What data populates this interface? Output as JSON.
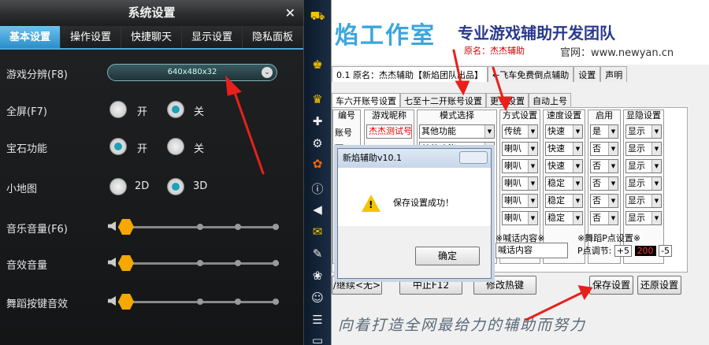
{
  "game_settings": {
    "title": "系统设置",
    "close": "✕",
    "tabs": [
      "基本设置",
      "操作设置",
      "快捷聊天",
      "显示设置",
      "隐私面板"
    ],
    "resolution": {
      "label": "游戏分辨(F8)",
      "value": "640x480x32"
    },
    "fullscreen": {
      "label": "全屏(F7)",
      "opt_on": "开",
      "opt_off": "关"
    },
    "gem": {
      "label": "宝石功能",
      "opt_on": "开",
      "opt_off": "关"
    },
    "minimap": {
      "label": "小地图",
      "opt_2d": "2D",
      "opt_3d": "3D"
    },
    "music_volume": {
      "label": "音乐音量(F6)",
      "level": 0
    },
    "sfx_volume": {
      "label": "音效音量",
      "level": 0
    },
    "dance_key_sound": {
      "label": "舞蹈按键音效",
      "level": 0
    }
  },
  "helper_app": {
    "banner_title": "焰工作室",
    "banner_sub": "专业游戏辅助开发团队",
    "banner_small": "原名：杰杰辅助",
    "banner_site": "官网：www.newyan.cn",
    "top_tabs": [
      "0.1 原名：杰杰辅助【新焰团队出品】",
      "←飞车免费倒点辅助",
      "设置",
      "声明"
    ],
    "account_tabs": [
      "车六开账号设置",
      "七至十二开账号设置",
      "更多设置",
      "自动上号"
    ],
    "columns": {
      "id": {
        "header": "编号",
        "cells": [
          "账号一",
          "",
          "",
          "",
          "",
          ""
        ]
      },
      "nickname": {
        "header": "游戏昵称",
        "cells": [
          "杰杰测试号码丶"
        ]
      },
      "mode": {
        "header": "模式选择",
        "cells": [
          "其他功能",
          "其他功能"
        ]
      },
      "method": {
        "header": "方式设置",
        "cells": [
          "传统",
          "喇叭",
          "喇叭",
          "喇叭",
          "喇叭",
          "喇叭"
        ]
      },
      "speed": {
        "header": "速度设置",
        "cells": [
          "快速",
          "快速",
          "快速",
          "稳定",
          "稳定",
          "稳定"
        ]
      },
      "enable": {
        "header": "启用",
        "cells": [
          "是",
          "否",
          "否",
          "否",
          "否",
          "否"
        ]
      },
      "visibility": {
        "header": "显隐设置",
        "cells": [
          "显示",
          "显示",
          "显示",
          "显示",
          "显示",
          "显示"
        ]
      }
    },
    "shout": {
      "title": "※喊话内容※",
      "value": "喊话内容"
    },
    "p_point": {
      "title": "※舞蹈P点设置※",
      "label": "P点调节:",
      "plus": "+5",
      "value": "200",
      "minus": "-5"
    },
    "buttons": {
      "continue": "/继续<无>",
      "stop": "中止F12",
      "hotkey": "修改热键",
      "save": "保存设置",
      "restore": "还原设置"
    },
    "slogan": "向着打造全网最给力的辅助而努力"
  },
  "dialog": {
    "title": "新焰辅助v10.1",
    "message": "保存设置成功！",
    "ok": "确定"
  }
}
